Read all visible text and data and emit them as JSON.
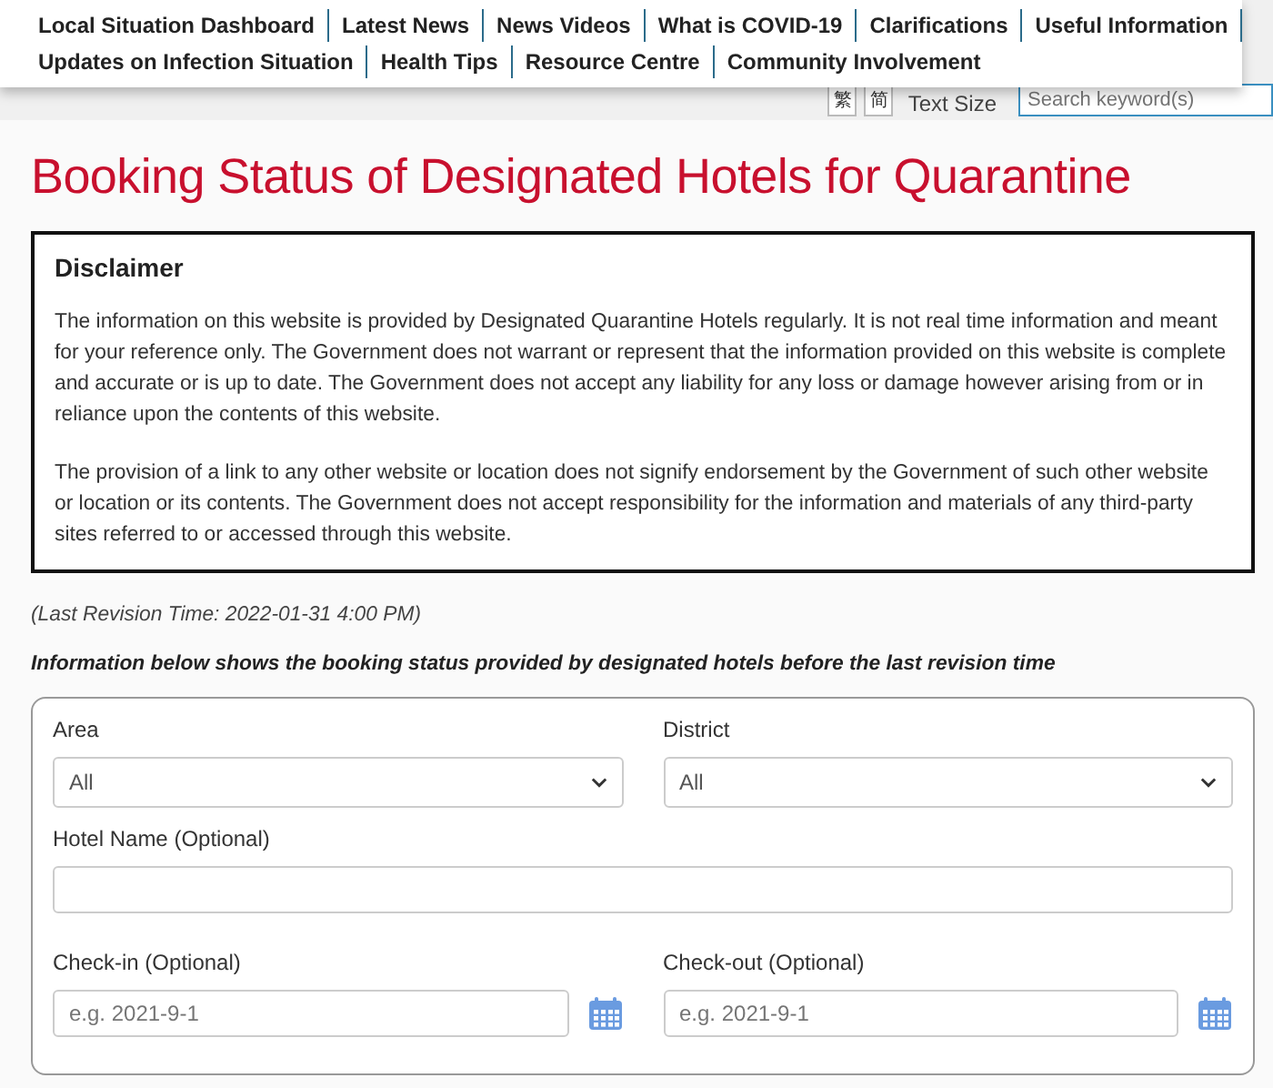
{
  "nav": {
    "rows": [
      [
        "Local Situation Dashboard",
        "Latest News",
        "News Videos",
        "What is COVID-19",
        "Clarifications",
        "Useful Information"
      ],
      [
        "Updates on Infection Situation",
        "Health Tips",
        "Resource Centre",
        "Community Involvement"
      ]
    ]
  },
  "toolbar": {
    "languages": [
      "繁",
      "简"
    ],
    "text_size": "Text Size",
    "search": {
      "placeholder": "Search keyword(s)"
    }
  },
  "title": "Booking Status of Designated Hotels for Quarantine",
  "disclaimer": {
    "heading": "Disclaimer",
    "paragraphs": [
      "The information on this website is provided by Designated Quarantine Hotels regularly. It is not real time information and meant for your reference only. The Government does not warrant or represent that the information provided on this website is complete and accurate or is up to date. The Government does not accept any liability for any loss or damage however arising from or in reliance upon the contents of this website.",
      "The provision of a link to any other website or location does not signify endorsement by the Government of such other website or location or its contents. The Government does not accept responsibility for the information and materials of any third-party sites referred to or accessed through this website."
    ]
  },
  "revision": "(Last Revision Time: 2022-01-31 4:00 PM)",
  "info": "Information below shows the booking status provided by designated hotels before the last revision time",
  "form": {
    "area": {
      "label": "Area",
      "value": "All"
    },
    "district": {
      "label": "District",
      "value": "All"
    },
    "hotel_name": {
      "label": "Hotel Name (Optional)"
    },
    "check_in": {
      "label": "Check-in (Optional)",
      "placeholder": "e.g. 2021-9-1"
    },
    "check_out": {
      "label": "Check-out (Optional)",
      "placeholder": "e.g. 2021-9-1"
    }
  }
}
